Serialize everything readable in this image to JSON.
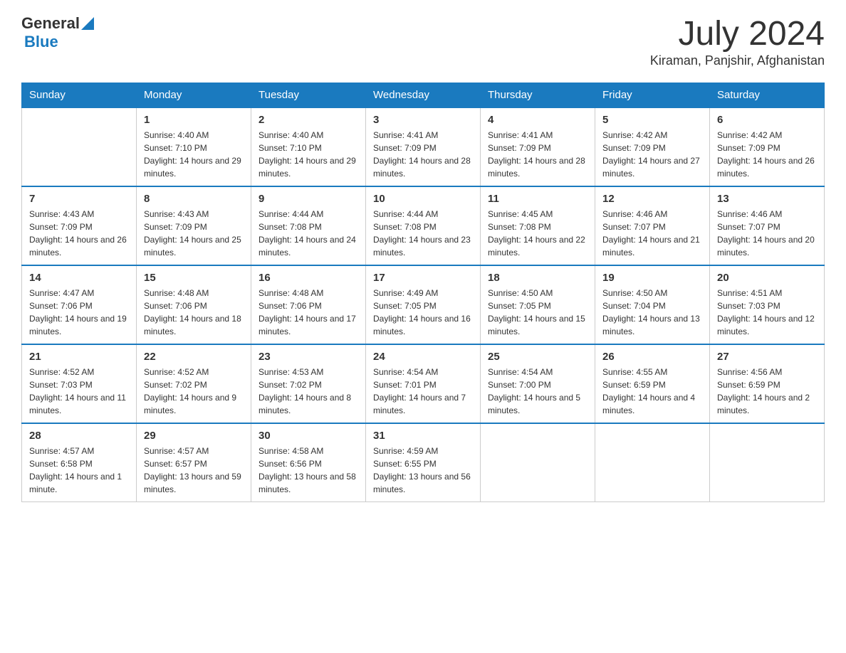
{
  "header": {
    "logo": {
      "general": "General",
      "blue": "Blue"
    },
    "title": "July 2024",
    "location": "Kiraman, Panjshir, Afghanistan"
  },
  "weekdays": [
    "Sunday",
    "Monday",
    "Tuesday",
    "Wednesday",
    "Thursday",
    "Friday",
    "Saturday"
  ],
  "weeks": [
    {
      "days": [
        {
          "number": "",
          "sunrise": "",
          "sunset": "",
          "daylight": ""
        },
        {
          "number": "1",
          "sunrise": "Sunrise: 4:40 AM",
          "sunset": "Sunset: 7:10 PM",
          "daylight": "Daylight: 14 hours and 29 minutes."
        },
        {
          "number": "2",
          "sunrise": "Sunrise: 4:40 AM",
          "sunset": "Sunset: 7:10 PM",
          "daylight": "Daylight: 14 hours and 29 minutes."
        },
        {
          "number": "3",
          "sunrise": "Sunrise: 4:41 AM",
          "sunset": "Sunset: 7:09 PM",
          "daylight": "Daylight: 14 hours and 28 minutes."
        },
        {
          "number": "4",
          "sunrise": "Sunrise: 4:41 AM",
          "sunset": "Sunset: 7:09 PM",
          "daylight": "Daylight: 14 hours and 28 minutes."
        },
        {
          "number": "5",
          "sunrise": "Sunrise: 4:42 AM",
          "sunset": "Sunset: 7:09 PM",
          "daylight": "Daylight: 14 hours and 27 minutes."
        },
        {
          "number": "6",
          "sunrise": "Sunrise: 4:42 AM",
          "sunset": "Sunset: 7:09 PM",
          "daylight": "Daylight: 14 hours and 26 minutes."
        }
      ]
    },
    {
      "days": [
        {
          "number": "7",
          "sunrise": "Sunrise: 4:43 AM",
          "sunset": "Sunset: 7:09 PM",
          "daylight": "Daylight: 14 hours and 26 minutes."
        },
        {
          "number": "8",
          "sunrise": "Sunrise: 4:43 AM",
          "sunset": "Sunset: 7:09 PM",
          "daylight": "Daylight: 14 hours and 25 minutes."
        },
        {
          "number": "9",
          "sunrise": "Sunrise: 4:44 AM",
          "sunset": "Sunset: 7:08 PM",
          "daylight": "Daylight: 14 hours and 24 minutes."
        },
        {
          "number": "10",
          "sunrise": "Sunrise: 4:44 AM",
          "sunset": "Sunset: 7:08 PM",
          "daylight": "Daylight: 14 hours and 23 minutes."
        },
        {
          "number": "11",
          "sunrise": "Sunrise: 4:45 AM",
          "sunset": "Sunset: 7:08 PM",
          "daylight": "Daylight: 14 hours and 22 minutes."
        },
        {
          "number": "12",
          "sunrise": "Sunrise: 4:46 AM",
          "sunset": "Sunset: 7:07 PM",
          "daylight": "Daylight: 14 hours and 21 minutes."
        },
        {
          "number": "13",
          "sunrise": "Sunrise: 4:46 AM",
          "sunset": "Sunset: 7:07 PM",
          "daylight": "Daylight: 14 hours and 20 minutes."
        }
      ]
    },
    {
      "days": [
        {
          "number": "14",
          "sunrise": "Sunrise: 4:47 AM",
          "sunset": "Sunset: 7:06 PM",
          "daylight": "Daylight: 14 hours and 19 minutes."
        },
        {
          "number": "15",
          "sunrise": "Sunrise: 4:48 AM",
          "sunset": "Sunset: 7:06 PM",
          "daylight": "Daylight: 14 hours and 18 minutes."
        },
        {
          "number": "16",
          "sunrise": "Sunrise: 4:48 AM",
          "sunset": "Sunset: 7:06 PM",
          "daylight": "Daylight: 14 hours and 17 minutes."
        },
        {
          "number": "17",
          "sunrise": "Sunrise: 4:49 AM",
          "sunset": "Sunset: 7:05 PM",
          "daylight": "Daylight: 14 hours and 16 minutes."
        },
        {
          "number": "18",
          "sunrise": "Sunrise: 4:50 AM",
          "sunset": "Sunset: 7:05 PM",
          "daylight": "Daylight: 14 hours and 15 minutes."
        },
        {
          "number": "19",
          "sunrise": "Sunrise: 4:50 AM",
          "sunset": "Sunset: 7:04 PM",
          "daylight": "Daylight: 14 hours and 13 minutes."
        },
        {
          "number": "20",
          "sunrise": "Sunrise: 4:51 AM",
          "sunset": "Sunset: 7:03 PM",
          "daylight": "Daylight: 14 hours and 12 minutes."
        }
      ]
    },
    {
      "days": [
        {
          "number": "21",
          "sunrise": "Sunrise: 4:52 AM",
          "sunset": "Sunset: 7:03 PM",
          "daylight": "Daylight: 14 hours and 11 minutes."
        },
        {
          "number": "22",
          "sunrise": "Sunrise: 4:52 AM",
          "sunset": "Sunset: 7:02 PM",
          "daylight": "Daylight: 14 hours and 9 minutes."
        },
        {
          "number": "23",
          "sunrise": "Sunrise: 4:53 AM",
          "sunset": "Sunset: 7:02 PM",
          "daylight": "Daylight: 14 hours and 8 minutes."
        },
        {
          "number": "24",
          "sunrise": "Sunrise: 4:54 AM",
          "sunset": "Sunset: 7:01 PM",
          "daylight": "Daylight: 14 hours and 7 minutes."
        },
        {
          "number": "25",
          "sunrise": "Sunrise: 4:54 AM",
          "sunset": "Sunset: 7:00 PM",
          "daylight": "Daylight: 14 hours and 5 minutes."
        },
        {
          "number": "26",
          "sunrise": "Sunrise: 4:55 AM",
          "sunset": "Sunset: 6:59 PM",
          "daylight": "Daylight: 14 hours and 4 minutes."
        },
        {
          "number": "27",
          "sunrise": "Sunrise: 4:56 AM",
          "sunset": "Sunset: 6:59 PM",
          "daylight": "Daylight: 14 hours and 2 minutes."
        }
      ]
    },
    {
      "days": [
        {
          "number": "28",
          "sunrise": "Sunrise: 4:57 AM",
          "sunset": "Sunset: 6:58 PM",
          "daylight": "Daylight: 14 hours and 1 minute."
        },
        {
          "number": "29",
          "sunrise": "Sunrise: 4:57 AM",
          "sunset": "Sunset: 6:57 PM",
          "daylight": "Daylight: 13 hours and 59 minutes."
        },
        {
          "number": "30",
          "sunrise": "Sunrise: 4:58 AM",
          "sunset": "Sunset: 6:56 PM",
          "daylight": "Daylight: 13 hours and 58 minutes."
        },
        {
          "number": "31",
          "sunrise": "Sunrise: 4:59 AM",
          "sunset": "Sunset: 6:55 PM",
          "daylight": "Daylight: 13 hours and 56 minutes."
        },
        {
          "number": "",
          "sunrise": "",
          "sunset": "",
          "daylight": ""
        },
        {
          "number": "",
          "sunrise": "",
          "sunset": "",
          "daylight": ""
        },
        {
          "number": "",
          "sunrise": "",
          "sunset": "",
          "daylight": ""
        }
      ]
    }
  ]
}
